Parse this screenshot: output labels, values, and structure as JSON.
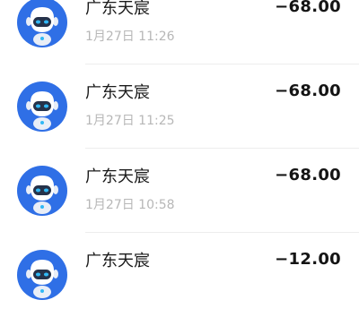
{
  "transactions": [
    {
      "merchant": "广东天宸",
      "time": "1月27日 11:26",
      "amount": "−68.00",
      "avatar_icon": "robot-avatar-icon"
    },
    {
      "merchant": "广东天宸",
      "time": "1月27日 11:25",
      "amount": "−68.00",
      "avatar_icon": "robot-avatar-icon"
    },
    {
      "merchant": "广东天宸",
      "time": "1月27日 10:58",
      "amount": "−68.00",
      "avatar_icon": "robot-avatar-icon"
    },
    {
      "merchant": "广东天宸",
      "time": "",
      "amount": "−12.00",
      "avatar_icon": "robot-avatar-icon"
    }
  ],
  "colors": {
    "avatar_ring": "#2f6fe6",
    "avatar_face": "#ffffff",
    "avatar_visor": "#25324a",
    "avatar_eyes": "#31b8f5",
    "avatar_body": "#e9eef7"
  }
}
